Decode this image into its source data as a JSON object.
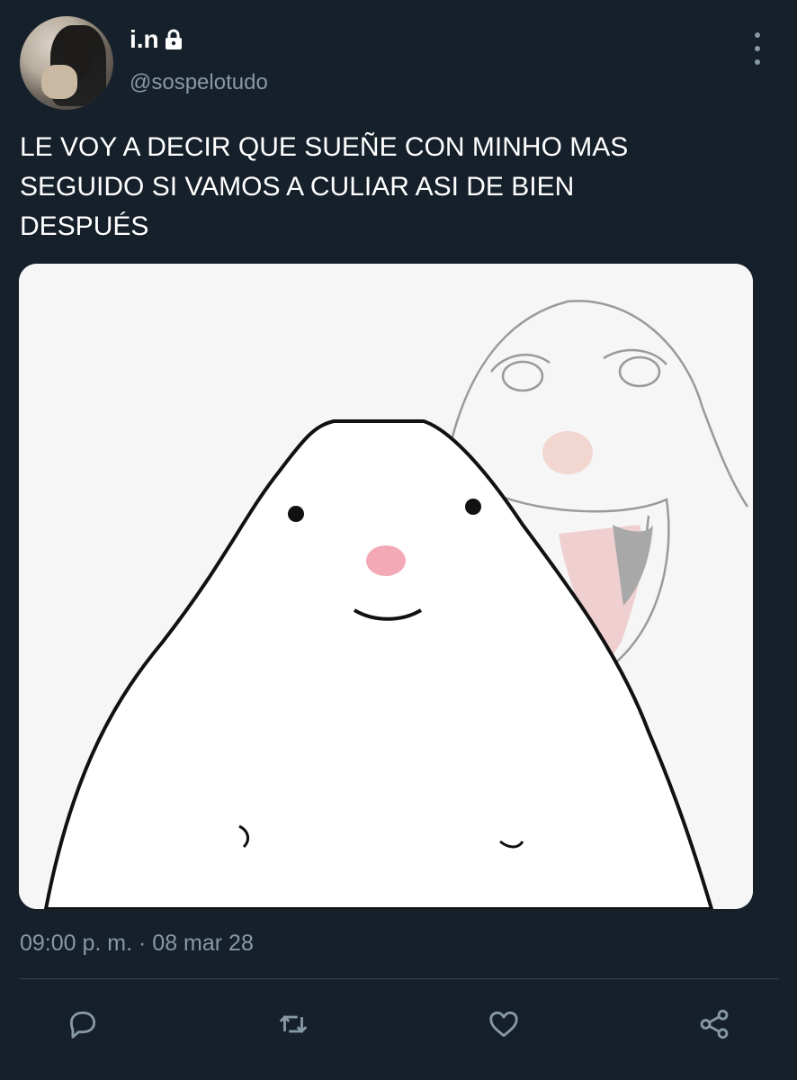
{
  "user": {
    "display_name": "i.n",
    "handle": "@sospelotudo",
    "protected_icon": "lock-icon"
  },
  "tweet": {
    "text": "LE VOY A DECIR QUE SUEÑE CON MINHO MAS\nSEGUIDO SI VAMOS A CULIAR ASI DE BIEN\nDESPUÉS",
    "timestamp": "09:00 p. m. · 08 mar 28",
    "media_description_icon": "meme-image"
  },
  "actions": [
    {
      "name": "reply",
      "icon": "reply-icon"
    },
    {
      "name": "retweet",
      "icon": "retweet-icon"
    },
    {
      "name": "like",
      "icon": "heart-icon"
    },
    {
      "name": "share",
      "icon": "share-icon"
    }
  ],
  "colors": {
    "background": "#15202b",
    "secondary_text": "#8899a6",
    "divider": "#38444d"
  }
}
